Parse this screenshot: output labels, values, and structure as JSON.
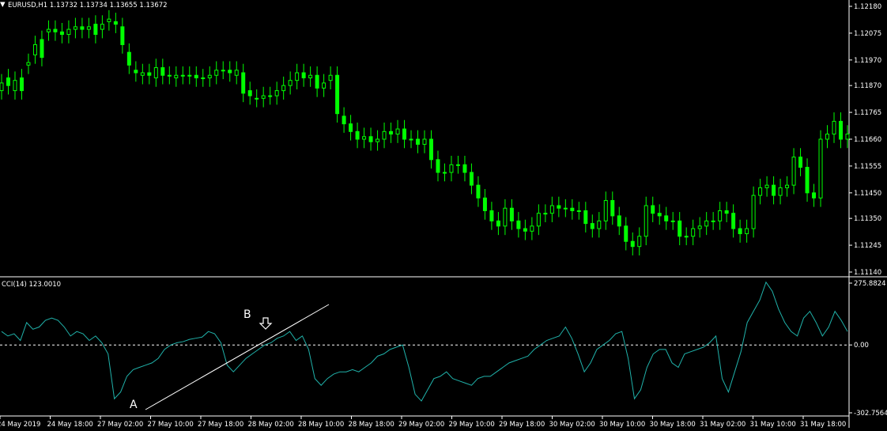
{
  "window": {
    "symbol_line": "EURUSD,H1  1.13732 1.13734 1.13655 1.13672",
    "cci_line": "CCI(14) 123.0010"
  },
  "annotations": {
    "point_a": "A",
    "point_b": "B",
    "arrow": "down-arrow-icon"
  },
  "colors": {
    "background": "#000000",
    "candle": "#00ff00",
    "cci": "#20b2aa",
    "trendline": "#ffffff",
    "axis_text": "#ffffff"
  },
  "chart_data": [
    {
      "type": "candlestick",
      "title": "EURUSD,H1",
      "ohlc_header": [
        1.13732,
        1.13734,
        1.13655,
        1.13672
      ],
      "ylim": [
        1.1114,
        1.1218
      ],
      "y_ticks": [
        "1.12180",
        "1.12075",
        "1.11970",
        "1.11870",
        "1.11765",
        "1.11660",
        "1.11555",
        "1.11450",
        "1.11350",
        "1.11245",
        "1.11140"
      ],
      "x_ticks": [
        "24 May 2019",
        "24 May 18:00",
        "27 May 02:00",
        "27 May 10:00",
        "27 May 18:00",
        "28 May 02:00",
        "28 May 10:00",
        "28 May 18:00",
        "29 May 02:00",
        "29 May 10:00",
        "29 May 18:00",
        "30 May 02:00",
        "30 May 10:00",
        "30 May 18:00",
        "31 May 02:00",
        "31 May 10:00",
        "31 May 18:00"
      ],
      "close": [
        1.1188,
        1.1187,
        1.1189,
        1.1185,
        1.1196,
        1.1203,
        1.1198,
        1.1209,
        1.1208,
        1.1207,
        1.1209,
        1.121,
        1.1209,
        1.121,
        1.1207,
        1.1211,
        1.1213,
        1.1211,
        1.1203,
        1.1195,
        1.1192,
        1.1192,
        1.1191,
        1.1194,
        1.1191,
        1.1191,
        1.1191,
        1.1191,
        1.1191,
        1.119,
        1.119,
        1.1191,
        1.1193,
        1.1193,
        1.1192,
        1.1193,
        1.1184,
        1.1183,
        1.1182,
        1.1183,
        1.1183,
        1.1185,
        1.1187,
        1.1189,
        1.1192,
        1.119,
        1.1191,
        1.1186,
        1.1188,
        1.1191,
        1.1176,
        1.1172,
        1.1169,
        1.1166,
        1.1167,
        1.1165,
        1.1166,
        1.1169,
        1.1168,
        1.117,
        1.1166,
        1.1166,
        1.1164,
        1.1166,
        1.1158,
        1.1153,
        1.1153,
        1.1156,
        1.1156,
        1.1153,
        1.1148,
        1.1143,
        1.1138,
        1.1134,
        1.1132,
        1.1139,
        1.1134,
        1.1131,
        1.113,
        1.1132,
        1.1137,
        1.1137,
        1.114,
        1.1139,
        1.1139,
        1.1138,
        1.1138,
        1.1133,
        1.1131,
        1.1134,
        1.1142,
        1.1136,
        1.1132,
        1.1126,
        1.1124,
        1.1128,
        1.114,
        1.1137,
        1.1136,
        1.1134,
        1.1134,
        1.1128,
        1.1128,
        1.1131,
        1.1132,
        1.1134,
        1.1134,
        1.1138,
        1.1137,
        1.1131,
        1.1129,
        1.1131,
        1.1144,
        1.1147,
        1.1148,
        1.1144,
        1.1147,
        1.1148,
        1.1159,
        1.1155,
        1.1145,
        1.1143,
        1.1166,
        1.1168,
        1.1173,
        1.1166,
        1.1168
      ],
      "open": [
        1.1185,
        1.119,
        1.1185,
        1.119,
        1.1195,
        1.1199,
        1.1205,
        1.1208,
        1.1209,
        1.1208,
        1.1207,
        1.1209,
        1.121,
        1.1209,
        1.1211,
        1.1209,
        1.1212,
        1.1212,
        1.121,
        1.12,
        1.1193,
        1.1191,
        1.1192,
        1.119,
        1.1194,
        1.1191,
        1.119,
        1.1191,
        1.1191,
        1.1191,
        1.119,
        1.119,
        1.1191,
        1.1193,
        1.1193,
        1.1191,
        1.1192,
        1.1185,
        1.1182,
        1.1182,
        1.1183,
        1.1183,
        1.1185,
        1.1187,
        1.1189,
        1.1192,
        1.119,
        1.1191,
        1.1186,
        1.1189,
        1.1191,
        1.1175,
        1.1172,
        1.1169,
        1.1166,
        1.1167,
        1.1165,
        1.1166,
        1.1169,
        1.1168,
        1.117,
        1.1166,
        1.1166,
        1.1164,
        1.1166,
        1.1158,
        1.1153,
        1.1153,
        1.1156,
        1.1156,
        1.1153,
        1.1148,
        1.1143,
        1.1138,
        1.1134,
        1.1132,
        1.1139,
        1.1134,
        1.1131,
        1.113,
        1.1132,
        1.1137,
        1.1137,
        1.114,
        1.1139,
        1.1139,
        1.1138,
        1.1138,
        1.1133,
        1.1131,
        1.1134,
        1.1142,
        1.1136,
        1.1132,
        1.1126,
        1.1124,
        1.1128,
        1.114,
        1.1137,
        1.1136,
        1.1134,
        1.1134,
        1.1128,
        1.1128,
        1.1131,
        1.1132,
        1.1134,
        1.1134,
        1.1138,
        1.1137,
        1.1131,
        1.1129,
        1.1131,
        1.1144,
        1.1147,
        1.1148,
        1.1144,
        1.1147,
        1.1148,
        1.1159,
        1.1155,
        1.1145,
        1.1143,
        1.1166,
        1.1168,
        1.1173,
        1.1166
      ]
    },
    {
      "type": "line",
      "title": "CCI(14)",
      "ylim": [
        -302.7564,
        275.8824
      ],
      "y_ticks": [
        "275.8824",
        "0.00",
        "-302.7564"
      ],
      "reference_line": 0,
      "values": [
        60,
        40,
        50,
        20,
        100,
        70,
        80,
        110,
        120,
        110,
        80,
        40,
        60,
        50,
        20,
        40,
        10,
        -40,
        -240,
        -210,
        -140,
        -110,
        -100,
        -90,
        -80,
        -60,
        -20,
        0,
        10,
        15,
        25,
        30,
        35,
        60,
        50,
        10,
        -90,
        -120,
        -90,
        -60,
        -40,
        -20,
        0,
        10,
        30,
        40,
        60,
        20,
        40,
        -20,
        -150,
        -180,
        -150,
        -130,
        -120,
        -120,
        -110,
        -120,
        -100,
        -80,
        -50,
        -40,
        -20,
        -10,
        0,
        -100,
        -220,
        -250,
        -200,
        -150,
        -140,
        -120,
        -150,
        -160,
        -170,
        -180,
        -150,
        -140,
        -140,
        -120,
        -100,
        -80,
        -70,
        -60,
        -50,
        -20,
        0,
        20,
        30,
        40,
        80,
        30,
        -40,
        -120,
        -80,
        -20,
        0,
        20,
        50,
        60,
        -60,
        -240,
        -200,
        -100,
        -40,
        -20,
        -20,
        -80,
        -100,
        -40,
        -30,
        -20,
        -10,
        10,
        40,
        -150,
        -210,
        -120,
        -30,
        100,
        150,
        200,
        280,
        240,
        160,
        100,
        60,
        40,
        120,
        150,
        100,
        40,
        80,
        150,
        110,
        60
      ]
    }
  ]
}
